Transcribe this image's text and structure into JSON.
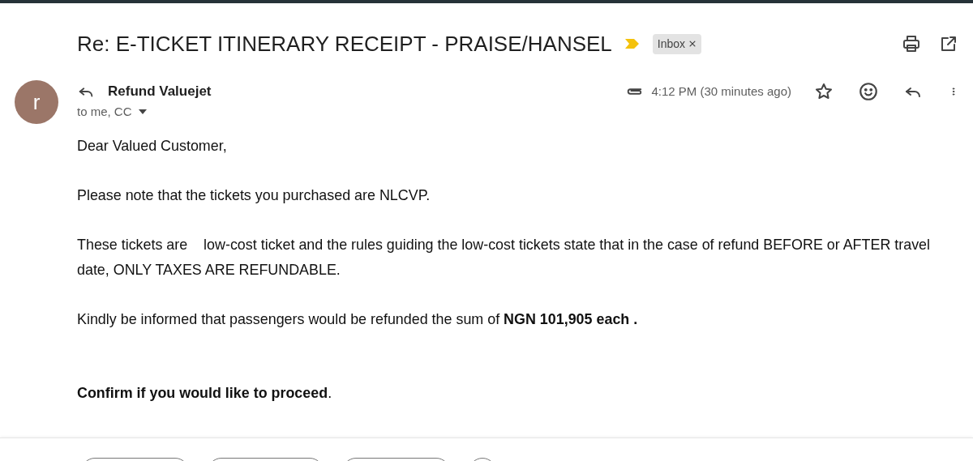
{
  "email": {
    "subject": "Re: E-TICKET ITINERARY RECEIPT - PRAISE/HANSEL",
    "important": true,
    "labels": [
      {
        "text": "Inbox",
        "removable": true
      }
    ],
    "sender": {
      "initial": "r",
      "color": "#9b7668",
      "name": "Refund Valuejet",
      "recipients": "to me, CC",
      "has_attachment": true,
      "time": "4:12 PM (30 minutes ago)",
      "starred": false
    },
    "body": [
      {
        "kind": "paragraph",
        "text": "Dear Valued Customer,"
      },
      {
        "kind": "paragraph",
        "text": "Please note that the tickets you purchased are NLCVP."
      },
      {
        "kind": "paragraph",
        "text": "These tickets are    low-cost ticket and the rules guiding the low-cost tickets state that in the case of refund BEFORE or AFTER travel date, ONLY TAXES ARE REFUNDABLE."
      },
      {
        "kind": "paragraph",
        "text": "Kindly be informed that passengers would be refunded the sum of **NGN 101,905 each .**"
      },
      {
        "kind": "call_to_action",
        "text": "**Confirm if you would like to proceed**."
      }
    ]
  },
  "footer_buttons": [
    {
      "kind": "pill"
    },
    {
      "kind": "pill"
    },
    {
      "kind": "pill"
    },
    {
      "kind": "round"
    }
  ]
}
